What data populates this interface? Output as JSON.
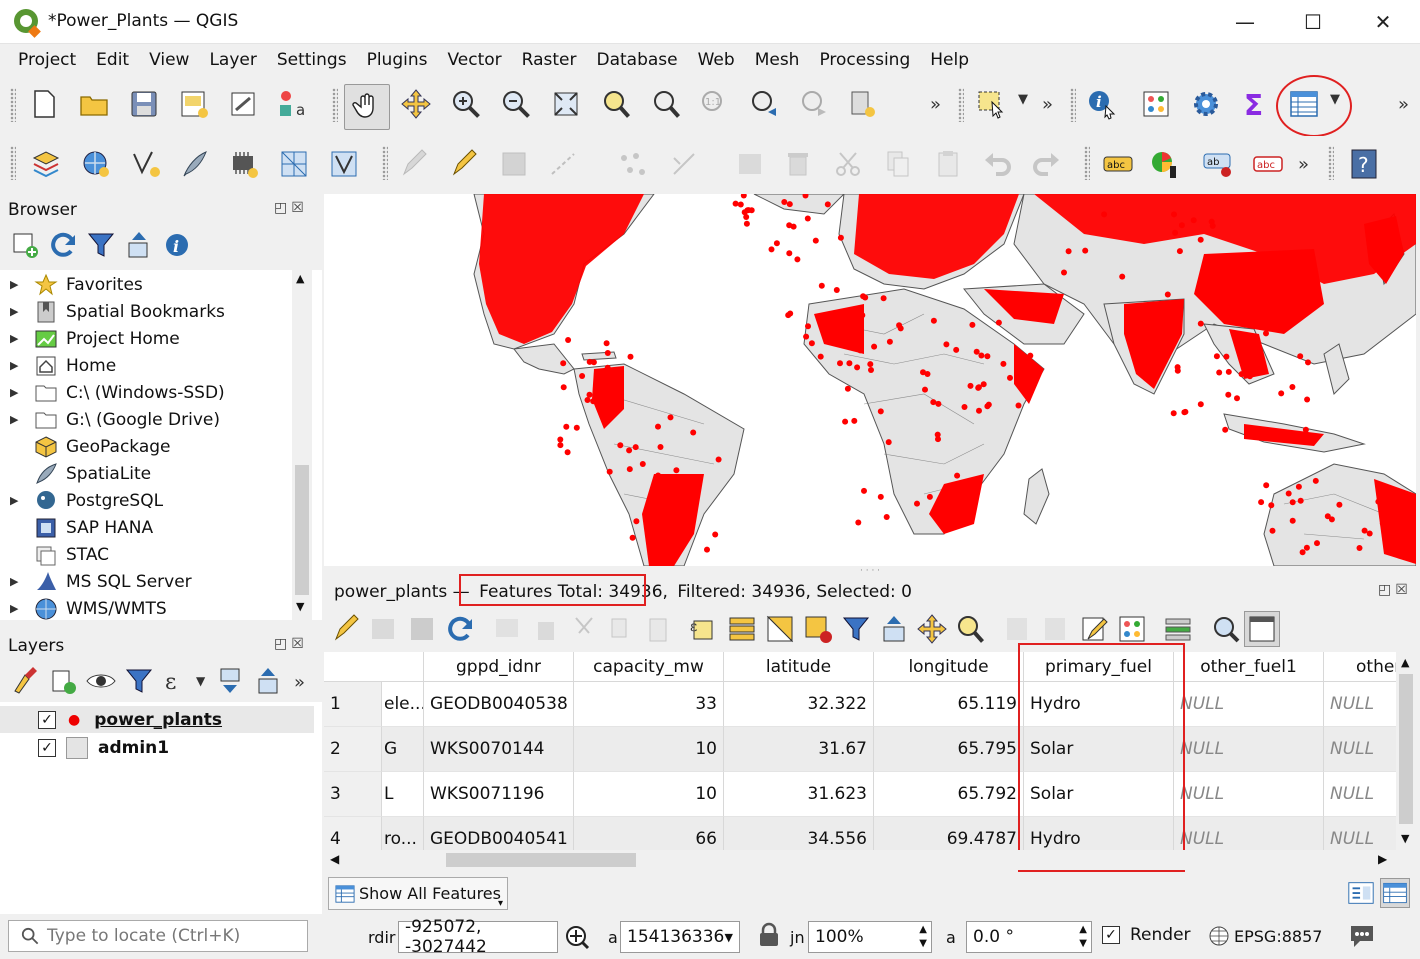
{
  "window": {
    "title": "*Power_Plants — QGIS",
    "minimize": "—",
    "maximize": "☐",
    "close": "✕"
  },
  "menu": [
    "Project",
    "Edit",
    "View",
    "Layer",
    "Settings",
    "Plugins",
    "Vector",
    "Raster",
    "Database",
    "Web",
    "Mesh",
    "Processing",
    "Help"
  ],
  "browser": {
    "title": "Browser",
    "items": [
      {
        "label": "Favorites",
        "icon": "star-icon",
        "expandable": true
      },
      {
        "label": "Spatial Bookmarks",
        "icon": "bookmark-icon",
        "expandable": true
      },
      {
        "label": "Project Home",
        "icon": "project-home-icon",
        "expandable": true
      },
      {
        "label": "Home",
        "icon": "home-icon",
        "expandable": true
      },
      {
        "label": "C:\\ (Windows-SSD)",
        "icon": "folder-icon",
        "expandable": true
      },
      {
        "label": "G:\\ (Google Drive)",
        "icon": "folder-icon",
        "expandable": true
      },
      {
        "label": "GeoPackage",
        "icon": "geopackage-icon",
        "expandable": false
      },
      {
        "label": "SpatiaLite",
        "icon": "spatialite-icon",
        "expandable": false
      },
      {
        "label": "PostgreSQL",
        "icon": "postgresql-icon",
        "expandable": true
      },
      {
        "label": "SAP HANA",
        "icon": "sap-hana-icon",
        "expandable": false
      },
      {
        "label": "STAC",
        "icon": "stac-icon",
        "expandable": false
      },
      {
        "label": "MS SQL Server",
        "icon": "mssql-icon",
        "expandable": true
      },
      {
        "label": "WMS/WMTS",
        "icon": "globe-icon",
        "expandable": true
      }
    ]
  },
  "layers": {
    "title": "Layers",
    "items": [
      {
        "label": "power_plants",
        "checked": true,
        "active": true
      },
      {
        "label": "admin1",
        "checked": true,
        "active": false
      }
    ]
  },
  "attribute_table": {
    "layer": "power_plants",
    "separator": " — ",
    "features_total": "Features Total: 34936,",
    "filter_info": " Filtered: 34936, Selected: 0",
    "columns": [
      "",
      "gppd_idnr",
      "capacity_mw",
      "latitude",
      "longitude",
      "primary_fuel",
      "other_fuel1",
      "other"
    ],
    "rows": [
      {
        "num": "1",
        "name": "ele...",
        "gppd_idnr": "GEODB0040538",
        "capacity_mw": "33",
        "latitude": "32.322",
        "longitude": "65.119",
        "primary_fuel": "Hydro",
        "other_fuel1": "NULL",
        "other": "NULL"
      },
      {
        "num": "2",
        "name": "G",
        "gppd_idnr": "WKS0070144",
        "capacity_mw": "10",
        "latitude": "31.67",
        "longitude": "65.795",
        "primary_fuel": "Solar",
        "other_fuel1": "NULL",
        "other": "NULL"
      },
      {
        "num": "3",
        "name": "L",
        "gppd_idnr": "WKS0071196",
        "capacity_mw": "10",
        "latitude": "31.623",
        "longitude": "65.792",
        "primary_fuel": "Solar",
        "other_fuel1": "NULL",
        "other": "NULL"
      },
      {
        "num": "4",
        "name": "ro...",
        "gppd_idnr": "GEODB0040541",
        "capacity_mw": "66",
        "latitude": "34.556",
        "longitude": "69.4787",
        "primary_fuel": "Hydro",
        "other_fuel1": "NULL",
        "other": "NULL"
      }
    ],
    "show_features": "Show All Features"
  },
  "status": {
    "locator_placeholder": "Type to locate (Ctrl+K)",
    "coord_label": "rdir",
    "coordinate": "-925072, -3027442",
    "scale_label": "a",
    "scale": "154136336",
    "magnifier_label": "jn",
    "magnifier": "100%",
    "rotation_label": "a",
    "rotation": "0.0 °",
    "render_label": "Render",
    "render_checked": true,
    "crs": "EPSG:8857"
  },
  "colors": {
    "points": "#ff0000",
    "land": "#e4e4e4",
    "borders": "#555555",
    "highlight": "#e02020"
  }
}
